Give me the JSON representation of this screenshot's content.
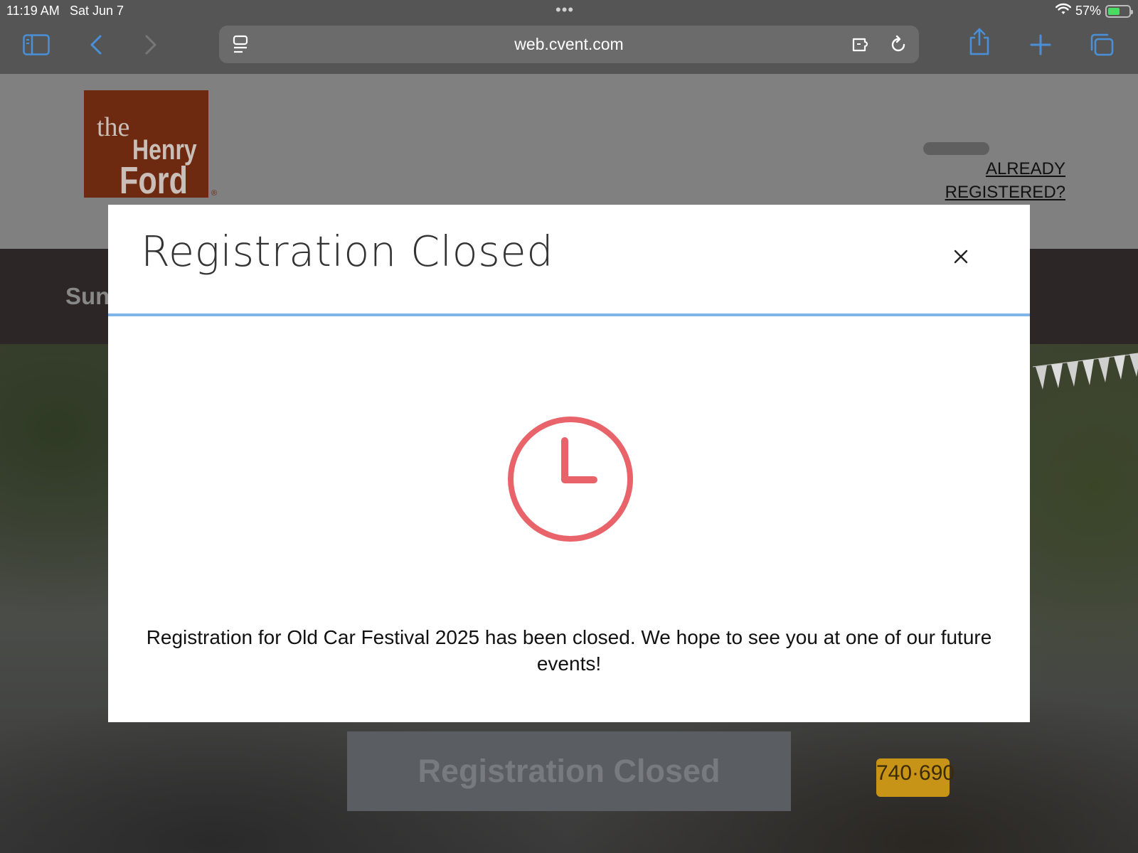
{
  "status_bar": {
    "time": "11:19 AM",
    "date": "Sat Jun 7",
    "multitask_dots": "•••",
    "battery_percent": "57%",
    "battery_level": 0.57
  },
  "browser": {
    "url": "web.cvent.com",
    "icons": {
      "sidebar": "sidebar-icon",
      "back": "back-chevron-icon",
      "forward": "forward-chevron-icon",
      "reader": "page-menu-icon",
      "extension": "extension-icon",
      "reload": "reload-icon",
      "share": "share-icon",
      "new_tab": "plus-icon",
      "tabs": "tabs-icon"
    },
    "accent_color": "#4a90d9"
  },
  "page": {
    "logo": {
      "the": "the",
      "henry": "Henry",
      "ford": "Ford",
      "registered_mark": "®"
    },
    "already_registered_line1": "ALREADY",
    "already_registered_line2": "REGISTERED?",
    "nav_partial_text": "Sun",
    "background_button": "Registration Closed",
    "plate_text": "740·690"
  },
  "modal": {
    "title": "Registration Closed",
    "close_symbol": "×",
    "icon": "clock-icon",
    "icon_color": "#e8646a",
    "message": "Registration for Old Car Festival 2025 has been closed. We hope to see you at one of our future events!"
  }
}
